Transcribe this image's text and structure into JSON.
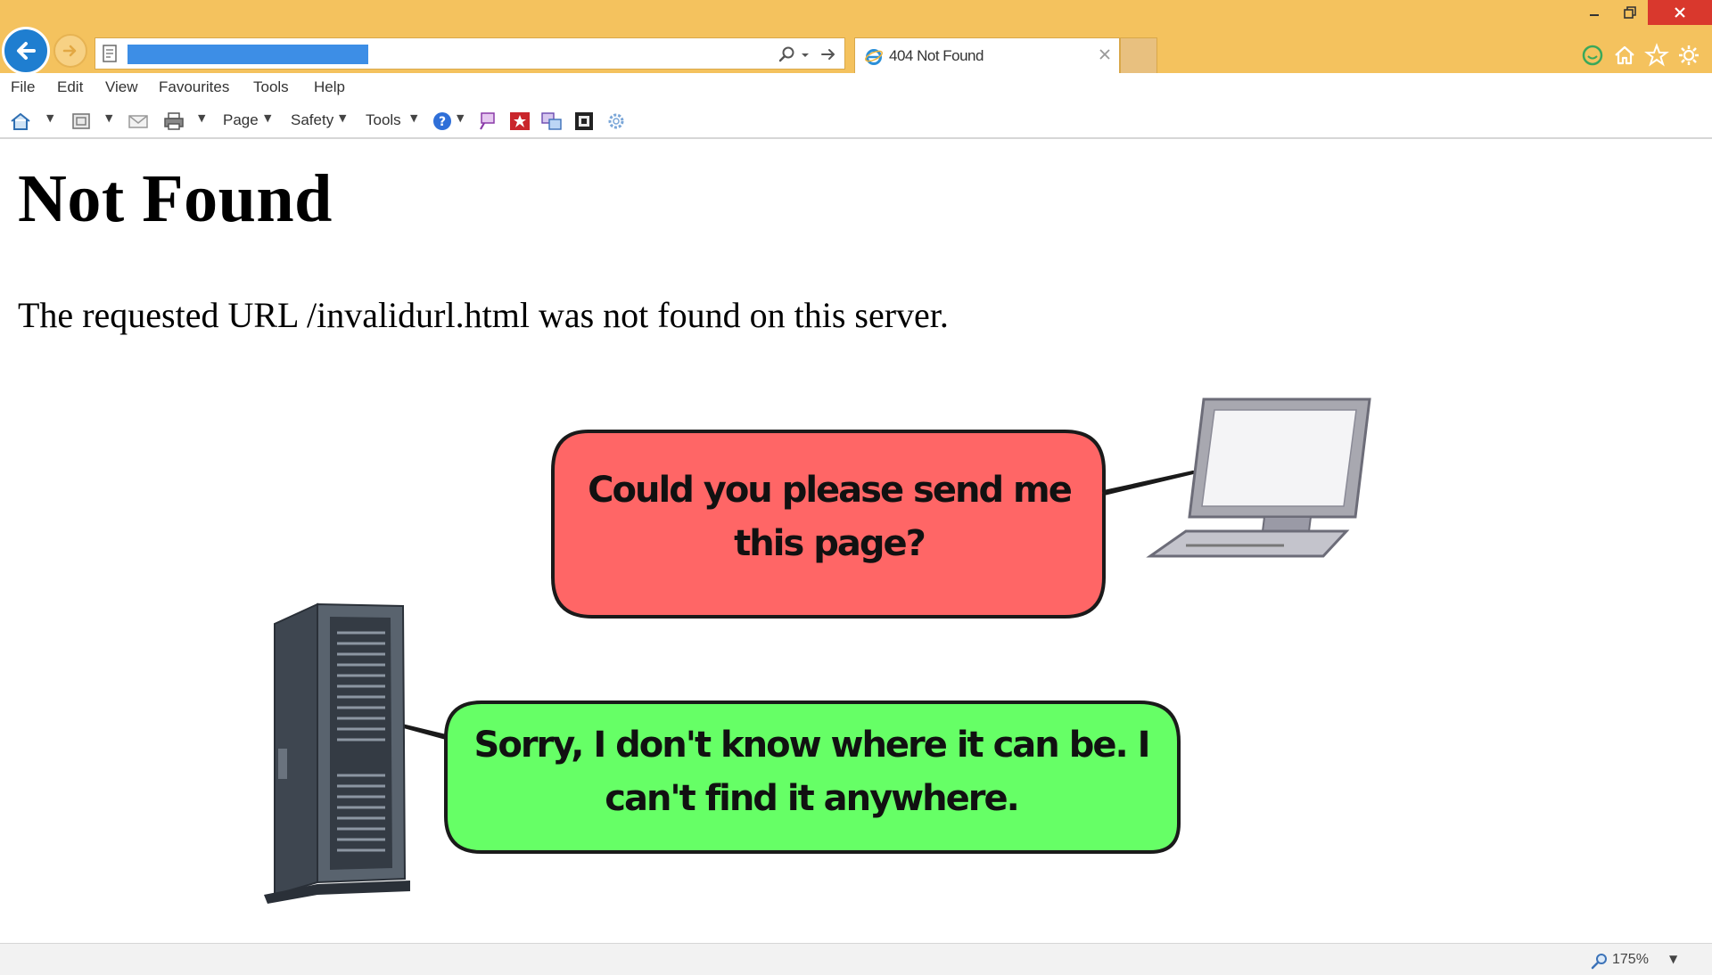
{
  "browser": {
    "tab_title": "404 Not Found",
    "url": "",
    "icons": {
      "back": "back-arrow-icon",
      "forward": "forward-arrow-icon",
      "page": "page-icon",
      "search": "search-icon",
      "go": "go-arrow-icon",
      "tab_favicon": "ie-favicon-icon",
      "tab_close": "close-icon",
      "minimize": "minimize-icon",
      "restore": "restore-icon",
      "window_close": "window-close-icon",
      "feedback": "smiley-icon",
      "home": "home-icon",
      "favorites": "star-icon",
      "settings": "gear-icon"
    },
    "colors": {
      "titlebar": "#f4c25e",
      "close_button": "#d9382d",
      "back_button": "#1f7ed0"
    }
  },
  "menubar": {
    "items": [
      "File",
      "Edit",
      "View",
      "Favourites",
      "Tools",
      "Help"
    ]
  },
  "commandbar": {
    "page_label": "Page",
    "safety_label": "Safety",
    "tools_label": "Tools"
  },
  "page": {
    "title": "Not Found",
    "message": "The requested URL /invalidurl.html was not found on this server.",
    "bubble_client": "Could you please send me this page?",
    "bubble_server": "Sorry, I don't know where it can be. I can't find it anywhere.",
    "colors": {
      "client_bubble": "#ff6666",
      "server_bubble": "#66ff66"
    }
  },
  "statusbar": {
    "zoom": "175%"
  }
}
